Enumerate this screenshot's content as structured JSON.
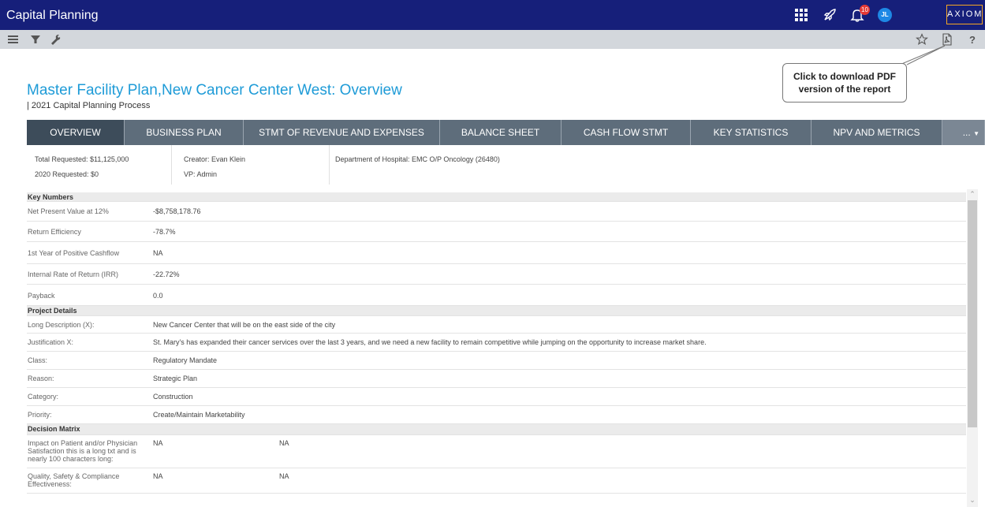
{
  "app": {
    "title": "Capital Planning",
    "logo_text": "AXIOM",
    "notification_count": "10",
    "avatar_initials": "JL",
    "accent_color": "#161f7a",
    "brand_color": "#f5a623"
  },
  "icons": {
    "topbar": [
      "apps-grid-icon",
      "rocket-icon",
      "bell-icon"
    ],
    "toolbar_left": [
      "menu-icon",
      "filter-icon",
      "wrench-icon"
    ],
    "toolbar_right": [
      "star-icon",
      "pdf-icon",
      "help-icon"
    ]
  },
  "callout": {
    "line1": "Click to download PDF",
    "line2": "version of the report"
  },
  "page": {
    "title": "Master Facility Plan,New Cancer Center West: Overview",
    "subtitle": "| 2021 Capital Planning Process"
  },
  "tabs": [
    {
      "label": "OVERVIEW",
      "active": true
    },
    {
      "label": "BUSINESS PLAN",
      "active": false
    },
    {
      "label": "STMT OF REVENUE AND EXPENSES",
      "active": false
    },
    {
      "label": "BALANCE SHEET",
      "active": false
    },
    {
      "label": "CASH FLOW STMT",
      "active": false
    },
    {
      "label": "KEY STATISTICS",
      "active": false
    },
    {
      "label": "NPV AND METRICS",
      "active": false
    },
    {
      "label": "...",
      "active": false
    }
  ],
  "summary": {
    "total_requested": "Total Requested: $11,125,000",
    "requested_2020": "2020 Requested: $0",
    "creator": "Creator: Evan Klein",
    "vp": "VP: Admin",
    "department": "Department of Hospital: EMC O/P Oncology (26480)"
  },
  "sections": {
    "key_numbers": "Key Numbers",
    "project_details": "Project Details",
    "decision_matrix": "Decision Matrix"
  },
  "key_numbers": [
    {
      "label": "Net Present Value at 12%",
      "value": "-$8,758,178.76"
    },
    {
      "label": "Return Efficiency",
      "value": "-78.7%"
    },
    {
      "label": "1st Year of Positive Cashflow",
      "value": "NA"
    },
    {
      "label": "Internal Rate of Return (IRR)",
      "value": "-22.72%"
    },
    {
      "label": "Payback",
      "value": "0.0"
    }
  ],
  "project_details": [
    {
      "label": "Long Description (X):",
      "value": "New Cancer Center that will be on the east side of the city"
    },
    {
      "label": "Justification X:",
      "value": "St. Mary's has expanded their cancer services over the last 3 years, and we need a new facility to remain competitive while jumping on the opportunity to increase market share."
    },
    {
      "label": "Class:",
      "value": "Regulatory Mandate"
    },
    {
      "label": "Reason:",
      "value": "Strategic Plan"
    },
    {
      "label": "Category:",
      "value": "Construction"
    },
    {
      "label": "Priority:",
      "value": "Create/Maintain Marketability"
    }
  ],
  "decision_matrix": [
    {
      "label_l1": "Impact on Patient and/or Physician",
      "label_l2": "Satisfaction this is a long txt and is",
      "label_l3": "nearly 100 characters long:",
      "value": "NA",
      "value2": "NA"
    },
    {
      "label_l1": "Quality, Safety & Compliance",
      "label_l2": "Effectiveness:",
      "label_l3": "",
      "value": "NA",
      "value2": "NA"
    }
  ]
}
